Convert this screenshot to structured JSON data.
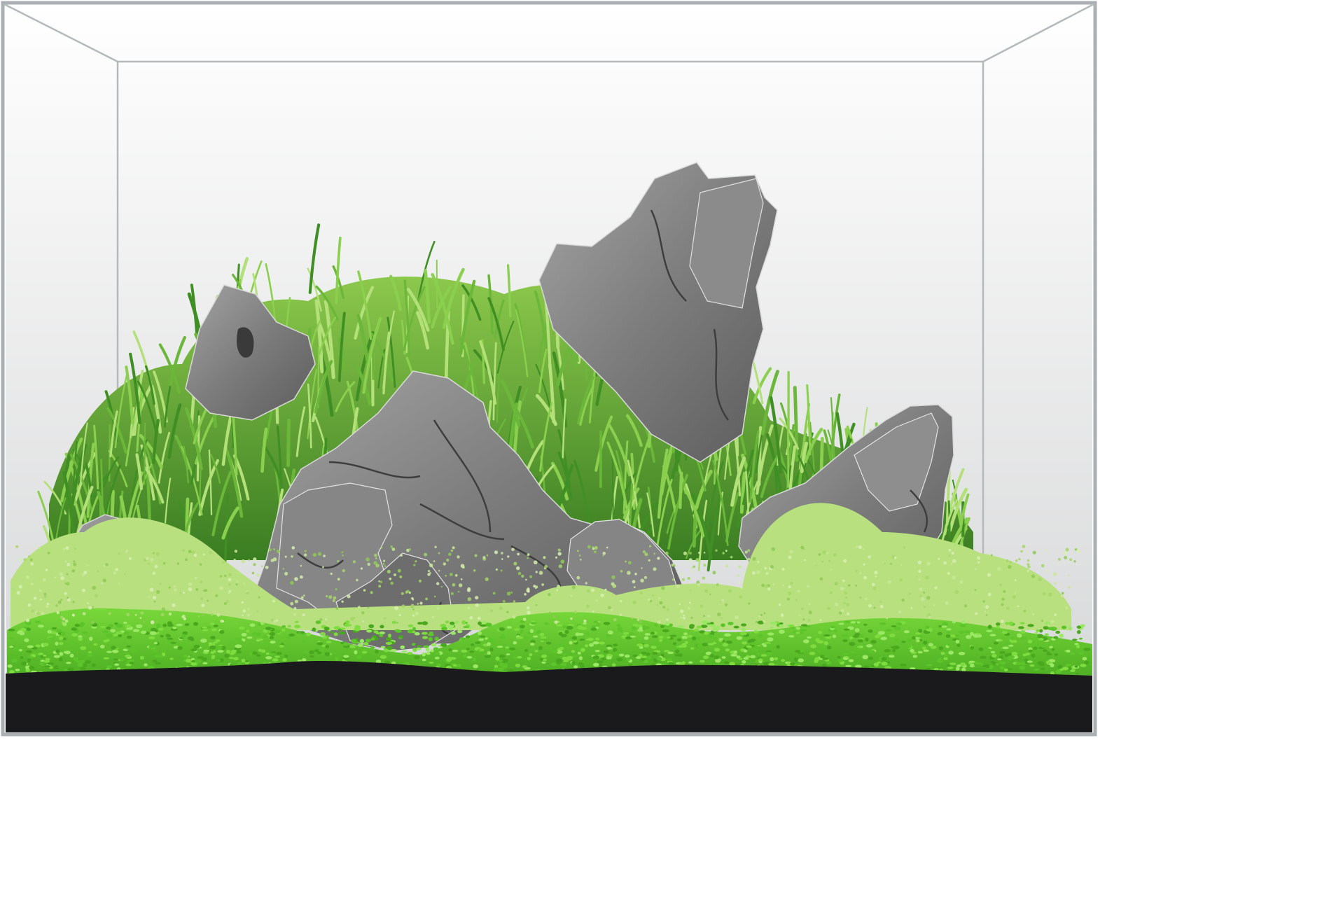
{
  "scene": {
    "name": "aquascape-illustration",
    "elements": [
      "glass-tank",
      "back-wall",
      "tall-grass-bush",
      "seiryu-stones",
      "carpet-plant",
      "dark-substrate"
    ]
  },
  "colors": {
    "frame": "#aab0b4",
    "wall_top": "#ffffff",
    "wall_bottom": "#d5d6d7",
    "rock_light": "#9a9a9a",
    "rock_mid": "#777777",
    "rock_dark": "#4a4a4a",
    "grass_dark": "#3f8f24",
    "grass_mid": "#6bb73a",
    "grass_light": "#b4e07a",
    "carpet_bright": "#67d62e",
    "carpet_pale": "#b8e07e",
    "substrate": "#1a1a1c"
  }
}
